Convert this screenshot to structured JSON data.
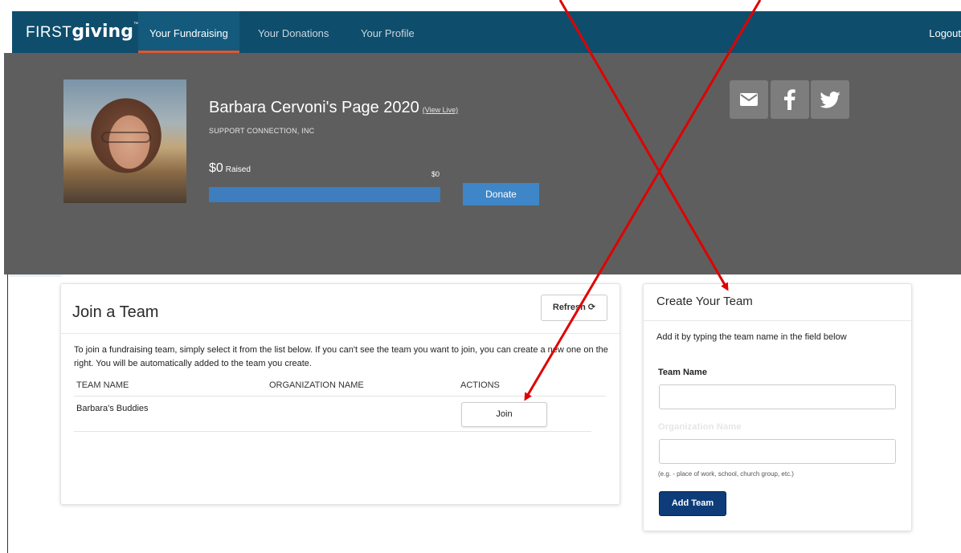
{
  "nav": {
    "logo_first": "FIRST",
    "logo_giving": "giving",
    "logo_tm": "™",
    "tabs": [
      {
        "label": "Your Fundraising",
        "active": true
      },
      {
        "label": "Your Donations",
        "active": false
      },
      {
        "label": "Your Profile",
        "active": false
      }
    ],
    "logout": "Logout"
  },
  "header": {
    "title": "Barbara Cervoni's Page 2020",
    "view_live": "(View Live)",
    "organization": "SUPPORT CONNECTION, INC",
    "raised_amount": "$0",
    "raised_label": "Raised",
    "goal_amount": "$0",
    "progress_fraction": 0,
    "donate_label": "Donate",
    "share_icons": [
      "email-icon",
      "facebook-icon",
      "twitter-icon"
    ]
  },
  "join_team": {
    "title": "Join a Team",
    "refresh_label": "Refresh",
    "description": "To join a fundraising team, simply select it from the list below. If you can't see the team you want to join, you can create a new one on the right. You will be automatically added to the team you create.",
    "columns": [
      "TEAM NAME",
      "ORGANIZATION NAME",
      "ACTIONS"
    ],
    "rows": [
      {
        "team_name": "Barbara's Buddies",
        "organization_name": "",
        "action": "Join"
      }
    ]
  },
  "create_team": {
    "title": "Create Your Team",
    "description": "Add it by typing the team name in the field below",
    "team_name_label": "Team Name",
    "team_name_value": "",
    "org_name_label": "Organization Name",
    "org_name_value": "",
    "org_hint": "(e.g. - place of work, school, church group, etc.)",
    "add_label": "Add Team"
  },
  "colors": {
    "nav_bg": "#0f4d6c",
    "active_underline": "#e1562f",
    "hero_bg": "#5e5e5e",
    "donate_bg": "#3e86c8",
    "add_team_bg": "#0d3c78",
    "annotation_arrow": "#e00000"
  }
}
